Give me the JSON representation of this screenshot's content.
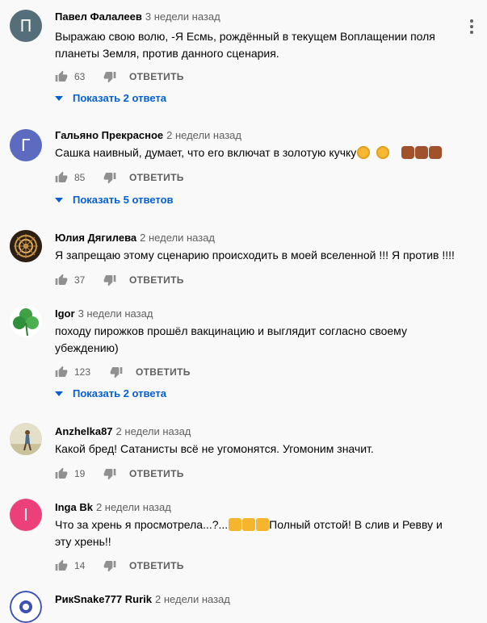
{
  "reply_label": "ОТВЕТИТЬ",
  "comments": [
    {
      "author": "Павел Фалалеев",
      "time": "3 недели назад",
      "avatar_letter": "П",
      "avatar_color": "#546e7a",
      "text_line1": "Выражаю свою волю, -Я Есмь, рождённый в текущем Воплащении поля",
      "text_line2": "планеты Земля, против данного сценария.",
      "likes": "63",
      "replies": "Показать 2 ответа"
    },
    {
      "author": "Гальяно Прекрасное",
      "time": "2 недели назад",
      "avatar_letter": "Г",
      "avatar_color": "#5c6bc0",
      "text": "Сашка наивный, думает, что его включат в золотую кучку",
      "likes": "85",
      "replies": "Показать 5 ответов"
    },
    {
      "author": "Юлия Дягилева",
      "time": "2 недели назад",
      "text": "Я запрещаю этому сценарию происходить в моей вселенной !!! Я против !!!!",
      "likes": "37"
    },
    {
      "author": "Igor",
      "time": "3 недели назад",
      "text_line1": "походу пирожков прошёл вакцинацию и выглядит согласно своему",
      "text_line2": "убеждению)",
      "likes": "123",
      "replies": "Показать 2 ответа"
    },
    {
      "author": "Anzhelka87",
      "time": "2 недели назад",
      "text": "Какой бред! Сатанисты всё не угомонятся. Угомоним значит.",
      "likes": "19"
    },
    {
      "author": "Inga Bk",
      "time": "2 недели назад",
      "avatar_letter": "I",
      "avatar_color": "#ec407a",
      "text_line1a": "Что за хрень я просмотрела...?...",
      "text_line1b": "Полный отстой! В слив и Ревву и",
      "text_line2": "эту хрень!!",
      "likes": "14"
    },
    {
      "author": "PикSnake777 Rurik",
      "time": "2 недели назад"
    }
  ]
}
